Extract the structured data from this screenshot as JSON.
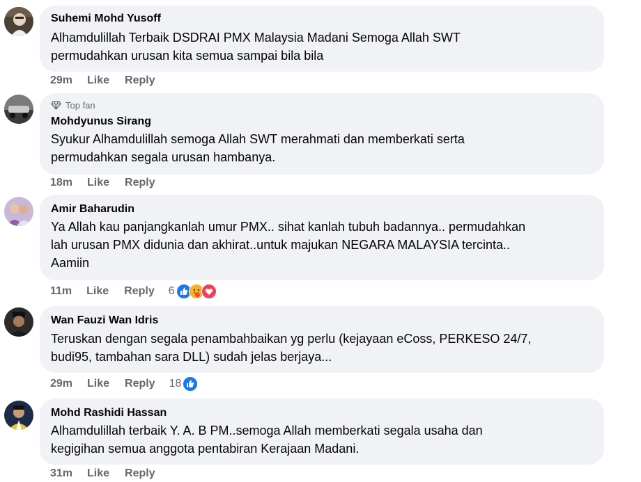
{
  "comments": [
    {
      "author": "Suhemi Mohd Yusoff",
      "badge": "",
      "text": "Alhamdulillah Terbaik DSDRAI PMX Malaysia Madani Semoga Allah SWT\npermudahkan urusan kita semua sampai bila bila",
      "time": "29m",
      "like_label": "Like",
      "reply_label": "Reply",
      "reaction_count": "",
      "reactions": []
    },
    {
      "author": "Mohdyunus Sirang",
      "badge": "Top fan",
      "text": "Syukur Alhamdulillah semoga Allah SWT merahmati dan memberkati serta\npermudahkan segala urusan hambanya.",
      "time": "18m",
      "like_label": "Like",
      "reply_label": "Reply",
      "reaction_count": "",
      "reactions": []
    },
    {
      "author": "Amir Baharudin",
      "badge": "",
      "text": "Ya Allah kau panjangkanlah umur PMX.. sihat kanlah tubuh badannya.. permudahkan\nlah urusan PMX didunia dan akhirat..untuk majukan NEGARA MALAYSIA tercinta..\nAamiin",
      "time": "11m",
      "like_label": "Like",
      "reply_label": "Reply",
      "reaction_count": "6",
      "reactions": [
        "like-icon",
        "care-icon",
        "love-icon"
      ]
    },
    {
      "author": "Wan Fauzi Wan Idris",
      "badge": "",
      "text": "Teruskan dengan segala penambahbaikan yg perlu (kejayaan eCoss, PERKESO 24/7,\nbudi95, tambahan sara DLL) sudah jelas berjaya...",
      "time": "29m",
      "like_label": "Like",
      "reply_label": "Reply",
      "reaction_count": "18",
      "reactions": [
        "like-icon"
      ]
    },
    {
      "author": "Mohd Rashidi Hassan",
      "badge": "",
      "text": "Alhamdulillah terbaik Y. A. B PM..semoga Allah memberkati segala usaha dan\nkegigihan semua anggota pentabiran Kerajaan Madani.",
      "time": "31m",
      "like_label": "Like",
      "reply_label": "Reply",
      "reaction_count": "",
      "reactions": []
    }
  ],
  "colors": {
    "bubble": "#f0f2f5",
    "meta": "#65676b",
    "like_blue": "#1877f2",
    "love_red": "#f33e58",
    "care_yellow": "#f7b125"
  }
}
